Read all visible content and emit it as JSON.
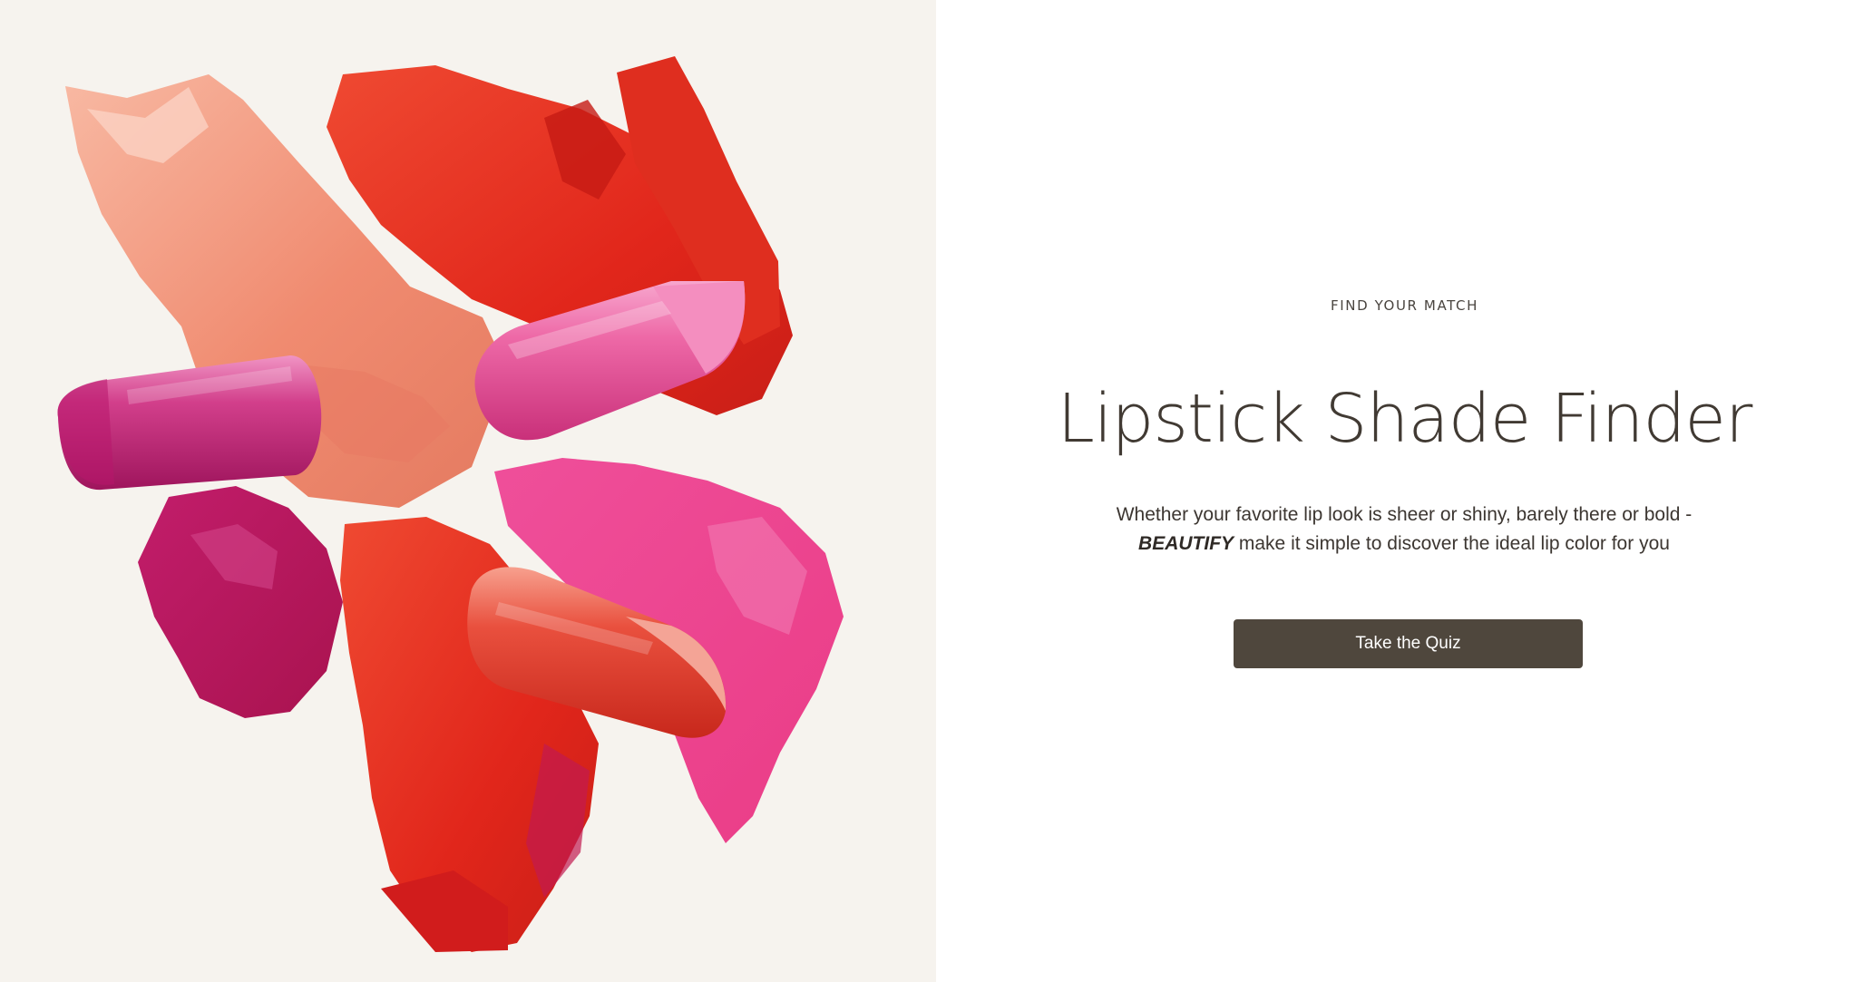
{
  "hero": {
    "image_name": "lipstick-swatches-image",
    "background_color": "#f6f3ee"
  },
  "content": {
    "eyebrow": "FIND YOUR MATCH",
    "title": "Lipstick Shade Finder",
    "description_line1": "Whether your favorite lip look is sheer or shiny, barely there or bold -",
    "brand_name": "BEAUTIFY",
    "description_line2": " make it simple to discover the ideal lip color for you",
    "cta_label": "Take the Quiz"
  },
  "colors": {
    "accent_button": "#4f473d",
    "heading_text": "#413a33"
  }
}
